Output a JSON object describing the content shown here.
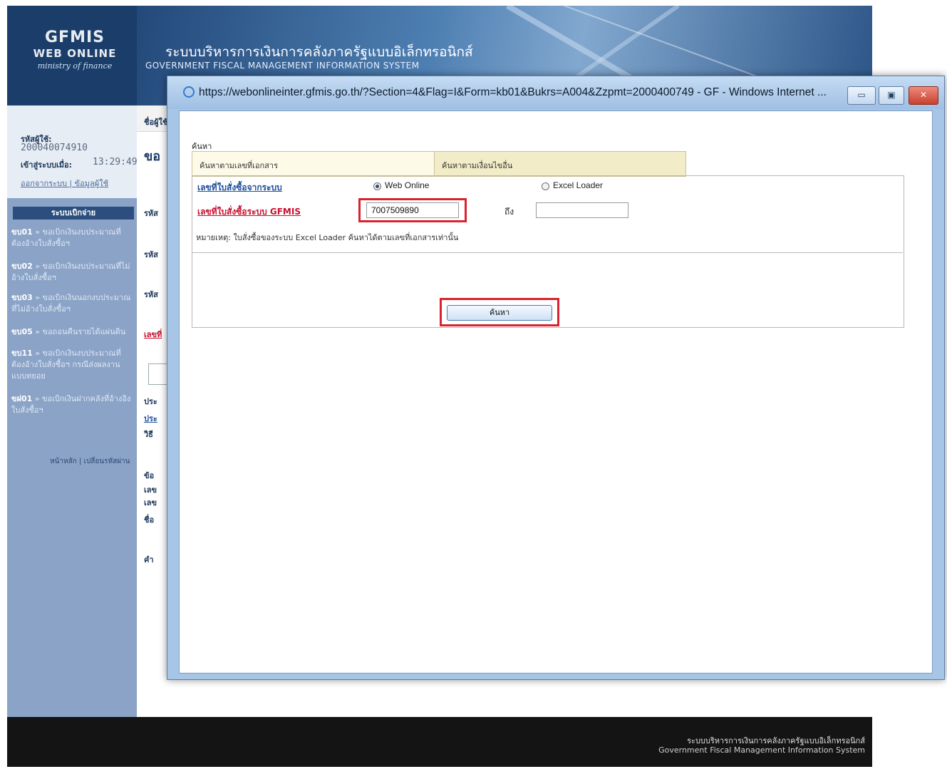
{
  "header": {
    "logo_text": "GFMIS",
    "logo_text2": "WEB ONLINE",
    "logo_sub": "ministry of finance",
    "title_th": "ระบบบริหารการเงินการคลังภาครัฐแบบอิเล็กทรอนิกส์",
    "title_en": "GOVERNMENT FISCAL MANAGEMENT INFORMATION SYSTEM"
  },
  "user": {
    "user_label": "รหัสผู้ใช้:",
    "user_id": "200040074910",
    "login_label": "เข้าสู่ระบบเมื่อ:",
    "login_time": "13:29:49",
    "logout_link": "ออกจากระบบ | ข้อมูลผู้ใช้"
  },
  "sidebar": {
    "menu_title": "ระบบเบิกจ่าย",
    "items": [
      {
        "code": "ขบ01",
        "label": "ขอเบิกเงินงบประมาณที่ต้องอ้างใบสั่งซื้อฯ"
      },
      {
        "code": "ขบ02",
        "label": "ขอเบิกเงินงบประมาณที่ไม่อ้างใบสั่งซื้อฯ"
      },
      {
        "code": "ขบ03",
        "label": "ขอเบิกเงินนอกงบประมาณที่ไม่อ้างใบสั่งซื้อฯ"
      },
      {
        "code": "ขบ05",
        "label": "ขอถอนคืนรายได้แผ่นดิน"
      },
      {
        "code": "ขบ11",
        "label": "ขอเบิกเงินงบประมาณที่ต้องอ้างใบสั่งซื้อฯ กรณีส่งผลงานแบบทยอย"
      },
      {
        "code": "ขฝ01",
        "label": "ขอเบิกเงินฝากคลังที่อ้างอิงใบสั่งซื้อฯ"
      }
    ],
    "footer_links": "หน้าหลัก | เปลี่ยนรหัสผ่าน"
  },
  "main": {
    "top_label": "ชื่อผู้ใช้",
    "heading": "ขอ",
    "row_labels": [
      "รหัส",
      "รหัส",
      "รหัส",
      "เลขที่",
      "ประ",
      "ประ",
      "วิธี",
      "ข้อ",
      "เลข",
      "เลข",
      "ชื่อ",
      "คำ"
    ]
  },
  "footer": {
    "line1": "ระบบบริหารการเงินการคลังภาครัฐแบบอิเล็กทรอนิกส์",
    "line2": "Government Fiscal Management Information System"
  },
  "popup": {
    "url_title": "https://webonlineinter.gfmis.go.th/?Section=4&Flag=I&Form=kb01&Bukrs=A004&Zzpmt=2000400749 - GF - Windows Internet ...",
    "panel_caption": "ค้นหา",
    "tab_by_doc": "ค้นหาตามเลขที่เอกสาร",
    "tab_other": "ค้นหาตามเงื่อนไขอื่น",
    "po_from_system_label": "เลขที่ใบสั่งซื้อจากระบบ",
    "radio_web_online": "Web Online",
    "radio_excel_loader": "Excel Loader",
    "po_gfmis_label": "เลขที่ใบสั่งซื้อระบบ GFMIS",
    "po_number": "7007509890",
    "to_label": "ถึง",
    "to_value": "",
    "note": "หมายเหตุ: ใบสั่งซื้อของระบบ Excel Loader ค้นหาได้ตามเลขที่เอกสารเท่านั้น",
    "search_button": "ค้นหา",
    "colors": {
      "red_highlight": "#d9222e",
      "link_blue": "#1f4f9c",
      "link_red": "#c8102e"
    }
  }
}
